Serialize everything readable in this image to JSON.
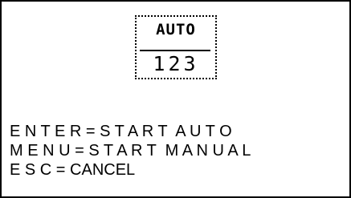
{
  "mode_box": {
    "mode_label": "AUTO",
    "counter_value": "123"
  },
  "instructions": [
    "E N T E R = S T A R T  A U T O",
    "M E N U = S T A R T  M A N U A L",
    "E S C = CANCEL"
  ]
}
